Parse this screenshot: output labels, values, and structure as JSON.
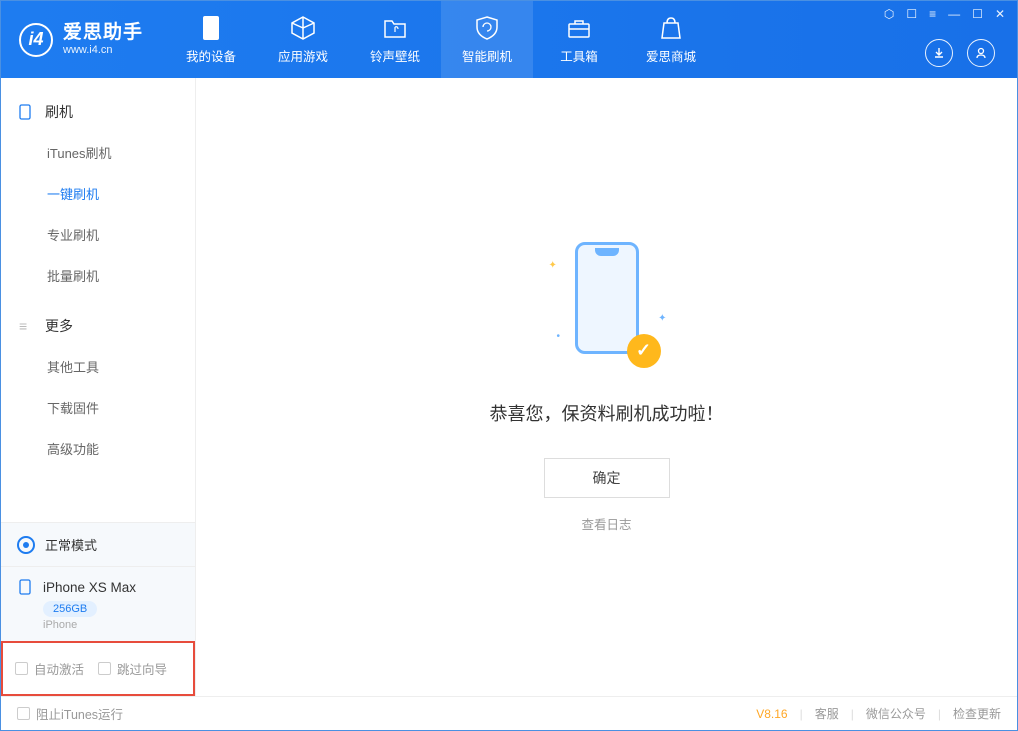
{
  "app": {
    "title": "爱思助手",
    "subtitle": "www.i4.cn"
  },
  "nav": [
    {
      "label": "我的设备"
    },
    {
      "label": "应用游戏"
    },
    {
      "label": "铃声壁纸"
    },
    {
      "label": "智能刷机"
    },
    {
      "label": "工具箱"
    },
    {
      "label": "爱思商城"
    }
  ],
  "sidebar": {
    "section1": "刷机",
    "items1": [
      "iTunes刷机",
      "一键刷机",
      "专业刷机",
      "批量刷机"
    ],
    "section2": "更多",
    "items2": [
      "其他工具",
      "下载固件",
      "高级功能"
    ]
  },
  "mode": {
    "label": "正常模式"
  },
  "device": {
    "name": "iPhone XS Max",
    "storage": "256GB",
    "type": "iPhone"
  },
  "checkboxes": {
    "auto_activate": "自动激活",
    "skip_guide": "跳过向导"
  },
  "main": {
    "success": "恭喜您，保资料刷机成功啦！",
    "ok": "确定",
    "log_link": "查看日志"
  },
  "footer": {
    "block_itunes": "阻止iTunes运行",
    "version": "V8.16",
    "support": "客服",
    "wechat": "微信公众号",
    "update": "检查更新"
  }
}
